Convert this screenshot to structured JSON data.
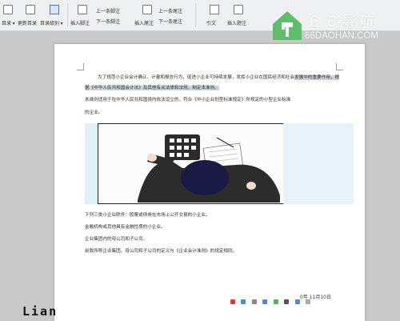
{
  "ribbon": {
    "groups": [
      {
        "label": "目录 ▾"
      },
      {
        "label": "更新目录"
      },
      {
        "label": "目录级别 ▾"
      },
      {
        "label": "插入脚注"
      },
      {
        "label": "上一条脚注"
      },
      {
        "label": "下一条脚注"
      },
      {
        "label": "插入尾注"
      },
      {
        "label": "上一条尾注"
      },
      {
        "label": "下一条尾注"
      },
      {
        "label": "引文"
      },
      {
        "label": "插入题注"
      }
    ]
  },
  "watermark": {
    "title": "６６导航",
    "url": "66DAOHAN.COM",
    "color": "#5cc06a"
  },
  "document": {
    "paragraphs": [
      {
        "pre": "为了规范小企业会计确认、计量和报告行为，促进小企业可持续发展，发挥小企业在国民经济和社会",
        "hl1": "发展中的重要作用，根据《中华人民共和国会计法》及其他有关法律和法规，制定本准则。"
      },
      {
        "text": "本准则适用于在中华人民共和国境内依法设立的、符合《中小企业划型标准规定》所规定的小型企业标准"
      },
      {
        "text": "的企业。"
      }
    ],
    "list": [
      "下列三类小企业除外：股票或债券在市场上公开交易的小企业。",
      "金融机构或其他具有金融性质的小企业。",
      "企业集团内的母公司和子公司。",
      "前款所称企业集团、母公司和子公司的定义与《企业会计准则》的规定相同。"
    ],
    "date": "0年 11月10日"
  },
  "signature": "Lian",
  "colors": {
    "ribbon_bg": "#eef0f2",
    "highlight": "#cfd3da",
    "illustration_bg": "#dff0f7"
  }
}
